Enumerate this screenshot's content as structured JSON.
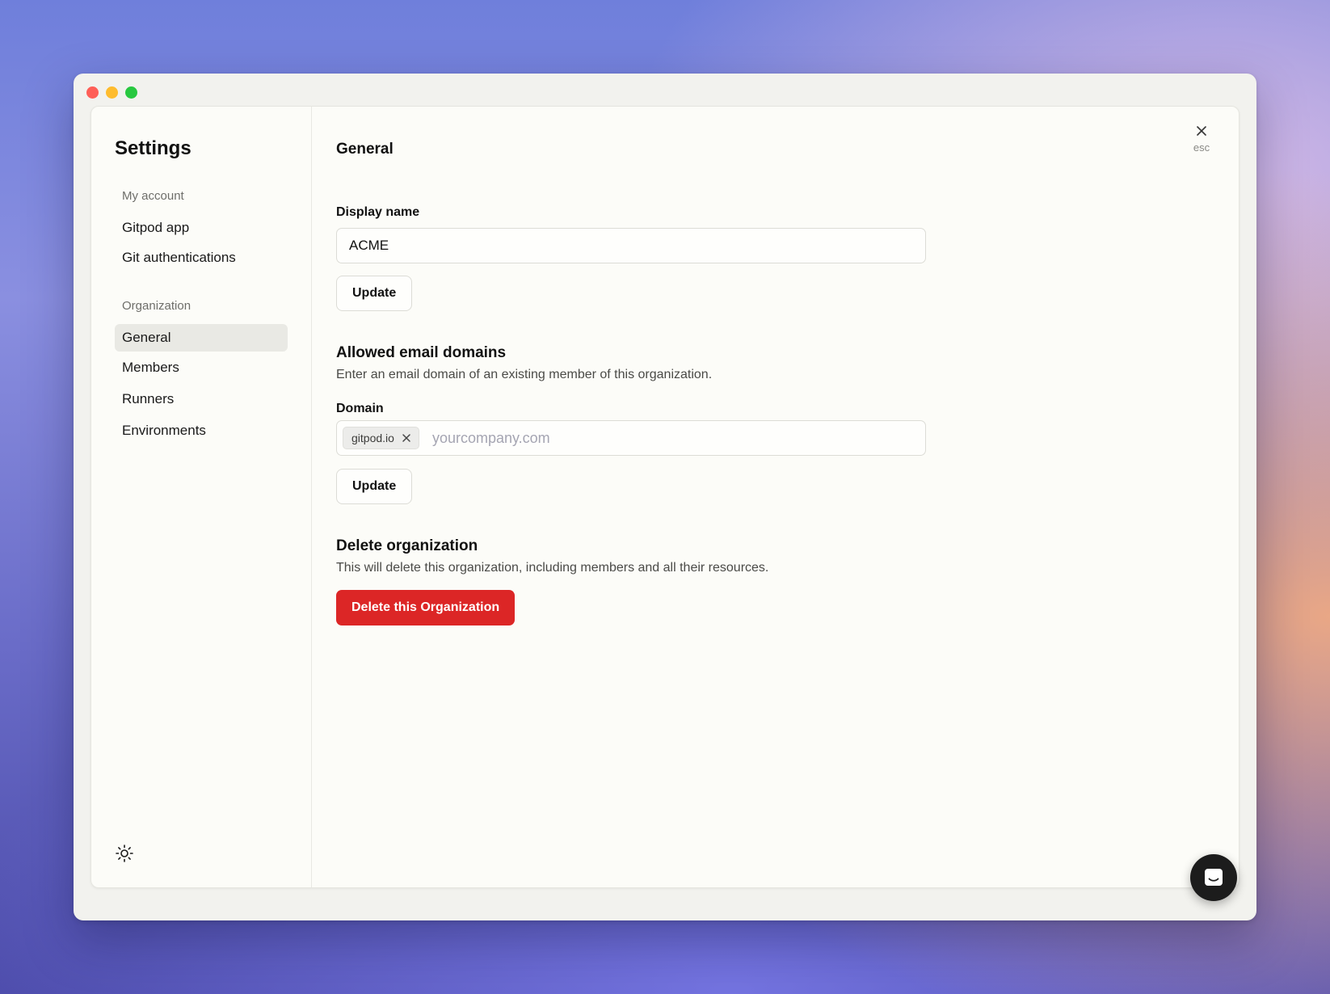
{
  "sidebar": {
    "title": "Settings",
    "sections": [
      {
        "label": "My account",
        "items": [
          {
            "label": "Gitpod app"
          },
          {
            "label": "Git authentications"
          }
        ]
      },
      {
        "label": "Organization",
        "items": [
          {
            "label": "General",
            "active": true
          },
          {
            "label": "Members"
          },
          {
            "label": "Runners"
          },
          {
            "label": "Environments"
          }
        ]
      }
    ],
    "theme_icon": "sun-icon"
  },
  "main": {
    "title": "General",
    "close": {
      "icon": "close-icon",
      "hint": "esc"
    },
    "display_name": {
      "label": "Display name",
      "value": "ACME",
      "button": "Update"
    },
    "email_domains": {
      "heading": "Allowed email domains",
      "description": "Enter an email domain of an existing member of this organization.",
      "field_label": "Domain",
      "tags": [
        "gitpod.io"
      ],
      "placeholder": "yourcompany.com",
      "button": "Update"
    },
    "delete_org": {
      "heading": "Delete organization",
      "description": "This will delete this organization, including members and all their resources.",
      "button": "Delete this Organization",
      "button_color": "#dc2626"
    }
  },
  "chat_widget": {
    "icon": "chat-icon"
  }
}
